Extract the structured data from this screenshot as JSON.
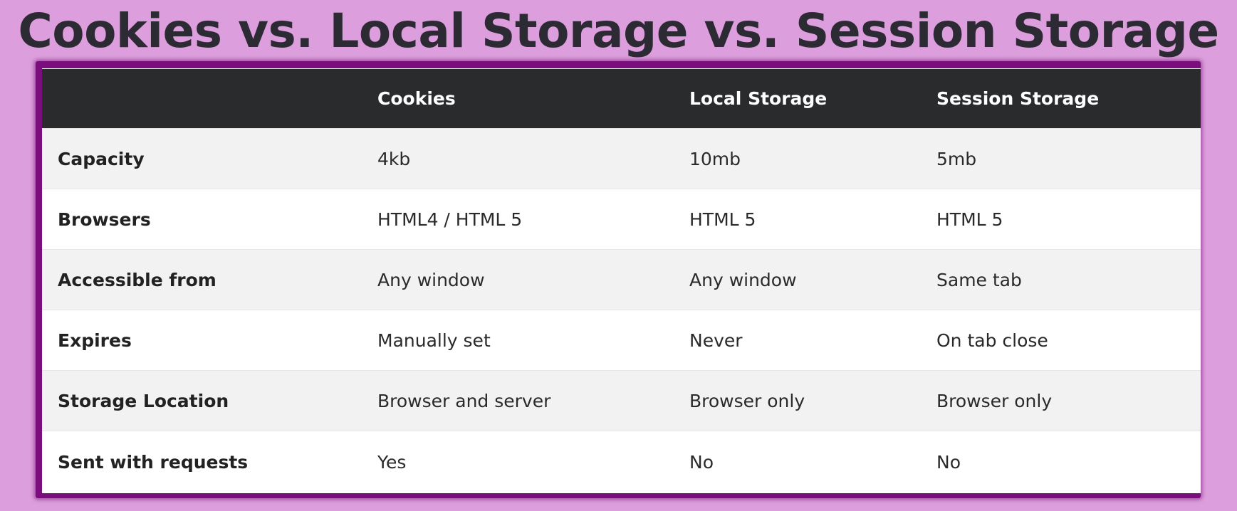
{
  "title": "Cookies vs. Local Storage vs. Session Storage",
  "table": {
    "headers": [
      "",
      "Cookies",
      "Local Storage",
      "Session Storage"
    ],
    "rows": [
      {
        "label": "Capacity",
        "cookies": "4kb",
        "local_storage": "10mb",
        "session_storage": "5mb"
      },
      {
        "label": "Browsers",
        "cookies": "HTML4 / HTML 5",
        "local_storage": "HTML 5",
        "session_storage": "HTML 5"
      },
      {
        "label": "Accessible from",
        "cookies": "Any window",
        "local_storage": "Any window",
        "session_storage": "Same tab"
      },
      {
        "label": "Expires",
        "cookies": "Manually set",
        "local_storage": "Never",
        "session_storage": "On tab close"
      },
      {
        "label": "Storage Location",
        "cookies": "Browser and server",
        "local_storage": "Browser only",
        "session_storage": "Browser only"
      },
      {
        "label": "Sent with requests",
        "cookies": "Yes",
        "local_storage": "No",
        "session_storage": "No"
      }
    ]
  },
  "colors": {
    "background": "#dc9edc",
    "frame": "#7a0e7c",
    "header_bg": "#2a2b2d",
    "row_alt": "#f2f2f2"
  }
}
